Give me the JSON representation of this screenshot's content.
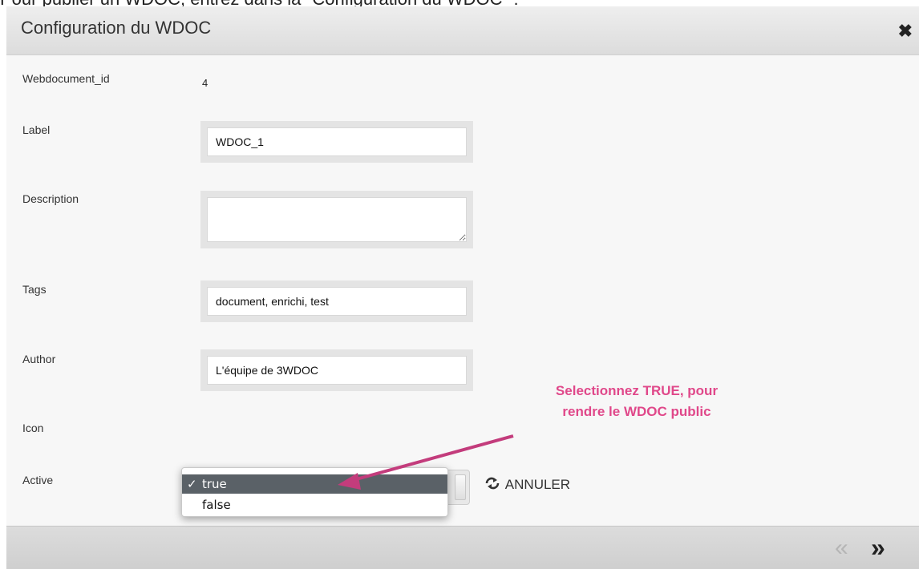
{
  "caption": "Pour publier un WDOC, entrez dans la \"Configuration du WDOC\" :",
  "dialog": {
    "title": "Configuration du WDOC",
    "close_icon": "close-icon"
  },
  "form": {
    "webdocument_id": {
      "label": "Webdocument_id",
      "value": "4"
    },
    "label": {
      "label": "Label",
      "value": "WDOC_1"
    },
    "description": {
      "label": "Description",
      "value": ""
    },
    "tags": {
      "label": "Tags",
      "value": "document, enrichi, test"
    },
    "author": {
      "label": "Author",
      "value": "L'équipe de 3WDOC"
    },
    "icon": {
      "label": "Icon"
    },
    "active": {
      "label": "Active",
      "options": [
        {
          "check": "✓",
          "text": "true"
        },
        {
          "check": "",
          "text": "false"
        }
      ],
      "selected": "true"
    }
  },
  "actions": {
    "annuler_label": "ANNULER",
    "annuler_icon": "refresh-icon"
  },
  "annotation": {
    "line1": "Selectionnez TRUE, pour",
    "line2": "rendre le WDOC public",
    "color": "#e0488a"
  },
  "footer": {
    "prev_symbol": "«",
    "next_symbol": "»",
    "prev_icon": "double-chevron-left-icon",
    "next_icon": "double-chevron-right-icon"
  }
}
